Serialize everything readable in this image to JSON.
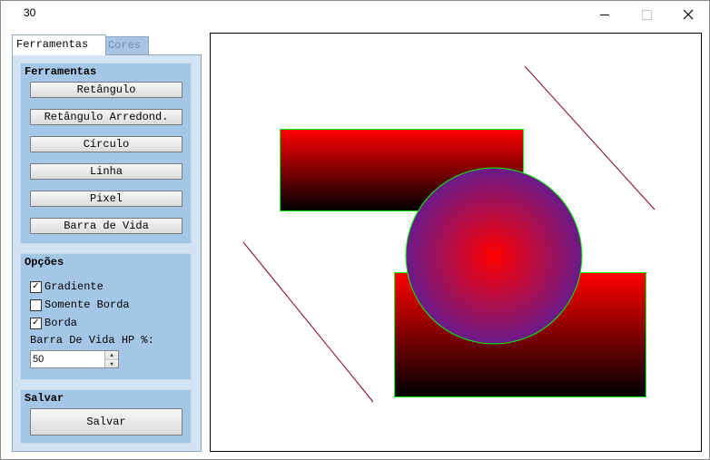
{
  "window": {
    "title": "30",
    "controls": [
      "minimize-icon",
      "maximize-icon",
      "close-icon"
    ]
  },
  "tabs": [
    {
      "label": "Ferramentas",
      "active": true
    },
    {
      "label": "Cores",
      "active": false
    }
  ],
  "tools_group": {
    "title": "Ferramentas",
    "buttons": [
      "Retângulo",
      "Retângulo Arredond.",
      "Círculo",
      "Linha",
      "Pixel",
      "Barra de Vida"
    ]
  },
  "options_group": {
    "title": "Opções",
    "checkboxes": [
      {
        "label": "Gradiente",
        "checked": true
      },
      {
        "label": "Somente Borda",
        "checked": false
      },
      {
        "label": "Borda",
        "checked": true
      }
    ],
    "hp_label": "Barra De Vida HP %:",
    "hp_value": "50"
  },
  "save_group": {
    "title": "Salvar",
    "button": "Salvar"
  },
  "canvas": {
    "gradient_top": "#ff0000",
    "gradient_bottom": "#000000",
    "circle_center": "#ff0000",
    "circle_edge": "#6a1a8a",
    "border_color": "#00ff00",
    "line_color": "#8b0030"
  }
}
